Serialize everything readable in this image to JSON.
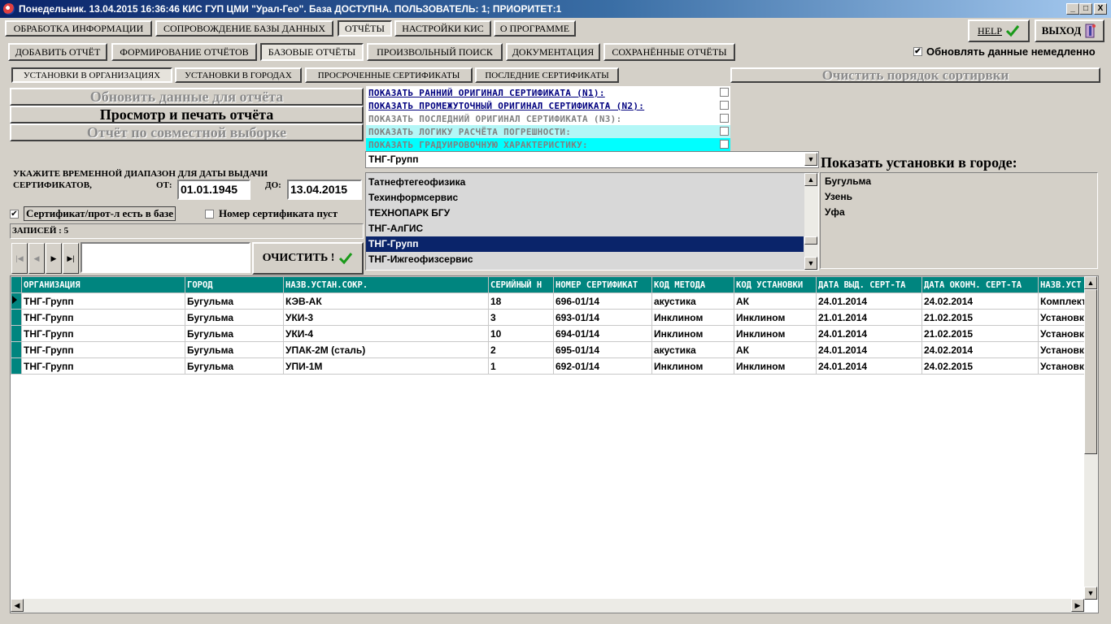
{
  "window": {
    "title": "Понедельник. 13.04.2015 16:36:46 КИС ГУП ЦМИ \"Урал-Гео\". База ДОСТУПНА. ПОЛЬЗОВАТЕЛЬ: 1; ПРИОРИТЕТ:1",
    "minimize": "_",
    "maximize": "□",
    "close": "X"
  },
  "main_tabs": [
    {
      "label": "ОБРАБОТКА ИНФОРМАЦИИ"
    },
    {
      "label": "СОПРОВОЖДЕНИЕ БАЗЫ ДАННЫХ"
    },
    {
      "label": "ОТЧЁТЫ"
    },
    {
      "label": "НАСТРОЙКИ КИС"
    },
    {
      "label": "О ПРОГРАММЕ"
    }
  ],
  "help_label": "HELP",
  "exit_label": "ВЫХОД",
  "report_tabs": [
    {
      "label": "ДОБАВИТЬ ОТЧЁТ"
    },
    {
      "label": "ФОРМИРОВАНИЕ ОТЧЁТОВ"
    },
    {
      "label": "БАЗОВЫЕ ОТЧЁТЫ"
    },
    {
      "label": "ПРОИЗВОЛЬНЫЙ ПОИСК"
    },
    {
      "label": "ДОКУМЕНТАЦИЯ"
    },
    {
      "label": "СОХРАНЁННЫЕ ОТЧЁТЫ"
    }
  ],
  "update_immediately": {
    "label": "Обновлять данные немедленно",
    "checked": true,
    "mark": "✔"
  },
  "base_tabs": [
    {
      "label": "УСТАНОВКИ В ОРГАНИЗАЦИЯХ"
    },
    {
      "label": "УСТАНОВКИ В ГОРОДАХ"
    },
    {
      "label": "ПРОСРОЧЕННЫЕ СЕРТИФИКАТЫ"
    },
    {
      "label": "ПОСЛЕДНИЕ СЕРТИФИКАТЫ"
    }
  ],
  "clear_sort_label": "Очистить порядок сортирвки",
  "actions": {
    "refresh": "Обновить данные для отчёта",
    "view_print": "Просмотр и печать отчёта",
    "joint": "Отчёт по совместной выборке"
  },
  "options": [
    {
      "label": "ПОКАЗАТЬ РАННИЙ ОРИГИНАЛ СЕРТИФИКАТА (N1):",
      "color": "#00007f",
      "bg": "#ffffff"
    },
    {
      "label": "ПОКАЗАТЬ ПРОМЕЖУТОЧНЫЙ ОРИГИНАЛ СЕРТИФИКАТА (N2):",
      "color": "#00007f",
      "bg": "#ffffff"
    },
    {
      "label": "ПОКАЗАТЬ ПОСЛЕДНИЙ ОРИГИНАЛ СЕРТИФИКАТА (N3):",
      "color": "#808080",
      "bg": "#ffffff"
    },
    {
      "label": "ПОКАЗАТЬ ЛОГИКУ РАСЧЁТА ПОГРЕШНОСТИ:",
      "color": "#808080",
      "bg": "#b3f7f7"
    },
    {
      "label": "ПОКАЗАТЬ ГРАДУИРОВОЧНУЮ ХАРАКТЕРИСТИКУ:",
      "color": "#808080",
      "bg": "#00ffff"
    }
  ],
  "org_select": {
    "value": "ТНГ-Групп"
  },
  "org_list": [
    "Татнефтегеофизика",
    "Техинформсервис",
    "ТЕХНОПАРК БГУ",
    "ТНГ-АлГИС",
    "ТНГ-Групп",
    "ТНГ-Ижгеофизсервис"
  ],
  "org_list_selected": 4,
  "city_header": "Показать установки в городе:",
  "cities": [
    "Бугульма",
    "Узень",
    "Уфа"
  ],
  "date_range": {
    "prompt": "УКАЖИТЕ ВРЕМЕННОЙ ДИАПАЗОН ДЛЯ ДАТЫ ВЫДАЧИ СЕРТИФИКАТОВ,",
    "from_label": "ОТ:",
    "from": "01.01.1945",
    "to_label": "ДО:",
    "to": "13.04.2015"
  },
  "filters": {
    "cert_in_db": {
      "label": "Сертификат/прот-л есть в базе",
      "checked": true,
      "mark": "✔"
    },
    "cert_number_empty": {
      "label": "Номер сертификата пуст",
      "checked": false
    }
  },
  "records_label": "ЗАПИСЕЙ : 5",
  "nav": {
    "first": "|◀",
    "prev": "◀",
    "next": "▶",
    "last": "▶|"
  },
  "clear_label": "ОЧИСТИТЬ !",
  "grid": {
    "columns": [
      "ОРГАНИЗАЦИЯ",
      "ГОРОД",
      "НАЗВ.УСТАН.СОКР.",
      "СЕРИЙНЫЙ Н",
      "НОМЕР СЕРТИФИКАТ",
      "КОД МЕТОДА",
      "КОД УСТАНОВКИ",
      "ДАТА ВЫД. СЕРТ-ТА",
      "ДАТА ОКОНЧ. СЕРТ-ТА",
      "НАЗВ.УСТ"
    ],
    "rows": [
      [
        "ТНГ-Групп",
        "Бугульма",
        "КЭВ-АК",
        "18",
        "696-01/14",
        "акустика",
        "АК",
        "24.01.2014",
        "24.02.2014",
        "Комплект"
      ],
      [
        "ТНГ-Групп",
        "Бугульма",
        "УКИ-3",
        "3",
        "693-01/14",
        "Инклином",
        "Инклином",
        "21.01.2014",
        "21.02.2015",
        "Установка"
      ],
      [
        "ТНГ-Групп",
        "Бугульма",
        "УКИ-4",
        "10",
        "694-01/14",
        "Инклином",
        "Инклином",
        "24.01.2014",
        "21.02.2015",
        "Установка"
      ],
      [
        "ТНГ-Групп",
        "Бугульма",
        "УПАК-2М (сталь)",
        "2",
        "695-01/14",
        "акустика",
        "АК",
        "24.01.2014",
        "24.02.2014",
        "Установка"
      ],
      [
        "ТНГ-Групп",
        "Бугульма",
        "УПИ-1М",
        "1",
        "692-01/14",
        "Инклином",
        "Инклином",
        "24.01.2014",
        "24.02.2015",
        "Установка"
      ]
    ]
  },
  "colors": {
    "accent": "#00857f",
    "selection": "#0a246a",
    "face": "#d4d0c8"
  }
}
